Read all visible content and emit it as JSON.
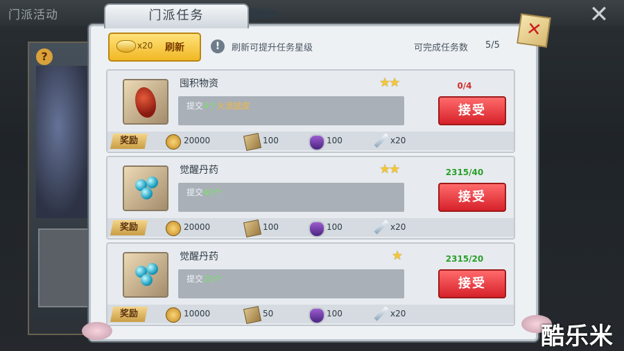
{
  "background": {
    "title": "门派活动"
  },
  "dialog": {
    "title": "门派任务",
    "refresh": {
      "count": "x20",
      "label": "刷新"
    },
    "hint": "刷新可提升任务星级",
    "complete_label": "可完成任务数",
    "complete_value": "5/5"
  },
  "tasks": [
    {
      "name": "囤积物资",
      "stars": "★★",
      "progress": "0/4",
      "progress_color": "#d0302a",
      "desc_prefix": "提交",
      "desc_count": "4个",
      "desc_item": "火流鼠皮",
      "accept": "接受",
      "reward_label": "奖励",
      "rewards": [
        "20000",
        "100",
        "100",
        "x20"
      ]
    },
    {
      "name": "觉醒丹药",
      "stars": "★★",
      "progress": "2315/40",
      "progress_color": "#2aa02a",
      "desc_prefix": "提交",
      "desc_count": "40个",
      "desc_item": "",
      "accept": "接受",
      "reward_label": "奖励",
      "rewards": [
        "20000",
        "100",
        "100",
        "x20"
      ]
    },
    {
      "name": "觉醒丹药",
      "stars": "★",
      "progress": "2315/20",
      "progress_color": "#2aa02a",
      "desc_prefix": "提交",
      "desc_count": "20个",
      "desc_item": "",
      "accept": "接受",
      "reward_label": "奖励",
      "rewards": [
        "10000",
        "50",
        "100",
        "x20"
      ]
    }
  ],
  "watermark": "酷乐米"
}
